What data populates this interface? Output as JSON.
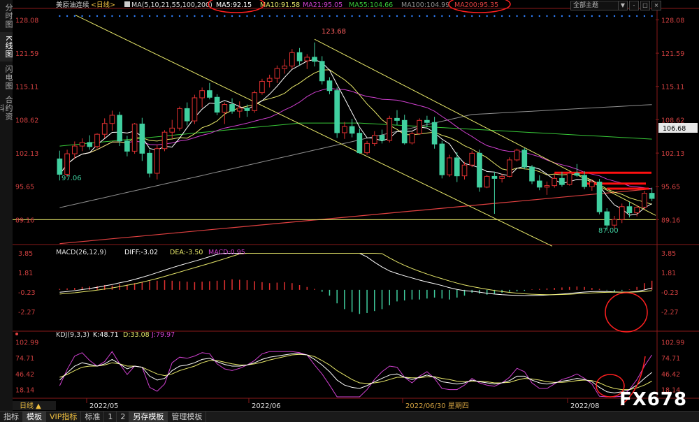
{
  "sidebar": {
    "tabs": [
      "分时图",
      "K线图",
      "闪电图",
      "合约资料"
    ],
    "active": 1
  },
  "header": {
    "symbol": "美原油连续",
    "period": "<日线>",
    "ma_label": "MA(5,10,21,55,100,200)",
    "ma_values": [
      {
        "label": "MA5:92.15",
        "color": "#ffffff"
      },
      {
        "label": "MA10:91.58",
        "color": "#e8e86a"
      },
      {
        "label": "MA21:95.05",
        "color": "#d040d0"
      },
      {
        "label": "MA55:104.66",
        "color": "#38c838"
      },
      {
        "label": "MA100:104.99",
        "color": "#909090"
      },
      {
        "label": "MA200:95.35",
        "color": "#e04040"
      }
    ],
    "theme": "全部主题",
    "buttons": [
      "▼",
      "-",
      "□",
      "×"
    ]
  },
  "main_axis": {
    "ticks": [
      "128.08",
      "121.59",
      "115.11",
      "108.62",
      "102.13",
      "95.65",
      "89.16"
    ],
    "last_price": "106.68"
  },
  "annotations": {
    "high": "123.68",
    "low_left": "97.06",
    "low_right": "87.00"
  },
  "macd": {
    "label": "MACD(26,12,9)",
    "diff": "DIFF:-3.02",
    "dea": "DEA:-3.50",
    "macd": "MACD:0.95",
    "ticks": [
      "3.85",
      "1.81",
      "-0.23",
      "-2.27"
    ]
  },
  "kdj": {
    "label": "KDJ(9,3,3)",
    "k": "K:48.71",
    "d": "D:33.08",
    "j": "J:79.97",
    "ticks": [
      "102.99",
      "74.71",
      "46.42",
      "18.14"
    ]
  },
  "date_axis": {
    "period_button": "日线 ▲",
    "labels": [
      "2022/05",
      "2022/06",
      "2022/06/30 星期四",
      "2022/08"
    ]
  },
  "bottom_tabs": [
    "指标",
    "模板",
    "VIP指标",
    "标准",
    "1",
    "2",
    "另存模板",
    "管理模板"
  ],
  "watermark": "FX678",
  "colors": {
    "up": "#e03030",
    "down": "#40d0a0",
    "ma5": "#ffffff",
    "ma10": "#e8e86a",
    "ma21": "#d040d0",
    "ma55": "#38c838",
    "ma100": "#909090",
    "ma200": "#e04040",
    "trend": "#e8e86a",
    "highlight": "#ff2020"
  },
  "chart_data": {
    "type": "candlestick",
    "candles": [
      [
        101.0,
        102.6,
        96.8,
        98.0
      ],
      [
        98.0,
        102.8,
        97.5,
        102.0
      ],
      [
        102.0,
        104.4,
        101.0,
        103.5
      ],
      [
        103.5,
        105.0,
        102.5,
        104.2
      ],
      [
        104.2,
        105.6,
        102.8,
        103.4
      ],
      [
        103.4,
        106.0,
        103.0,
        105.8
      ],
      [
        105.8,
        108.9,
        105.0,
        107.9
      ],
      [
        107.9,
        110.4,
        106.5,
        109.5
      ],
      [
        109.5,
        110.2,
        103.5,
        104.5
      ],
      [
        104.5,
        105.5,
        101.5,
        102.5
      ],
      [
        102.5,
        108.0,
        102.0,
        107.8
      ],
      [
        107.8,
        109.0,
        100.6,
        102.1
      ],
      [
        102.1,
        102.8,
        97.4,
        98.2
      ],
      [
        98.2,
        103.8,
        97.0,
        103.0
      ],
      [
        103.0,
        106.6,
        102.5,
        106.2
      ],
      [
        106.2,
        108.6,
        105.0,
        107.0
      ],
      [
        107.0,
        111.2,
        106.5,
        110.8
      ],
      [
        110.8,
        112.0,
        107.5,
        108.4
      ],
      [
        108.4,
        113.5,
        107.8,
        112.9
      ],
      [
        112.9,
        114.9,
        111.0,
        114.3
      ],
      [
        114.3,
        115.8,
        112.6,
        113.0
      ],
      [
        113.0,
        113.6,
        109.5,
        110.1
      ],
      [
        110.1,
        112.0,
        107.8,
        111.6
      ],
      [
        111.6,
        112.8,
        109.8,
        110.3
      ],
      [
        110.3,
        112.2,
        109.0,
        110.9
      ],
      [
        110.9,
        111.6,
        109.2,
        110.4
      ],
      [
        110.4,
        114.3,
        110.0,
        113.9
      ],
      [
        113.9,
        116.6,
        113.5,
        116.1
      ],
      [
        116.1,
        117.4,
        114.9,
        116.7
      ],
      [
        116.7,
        119.2,
        115.8,
        118.6
      ],
      [
        118.6,
        120.4,
        117.6,
        119.1
      ],
      [
        119.1,
        122.4,
        118.5,
        121.7
      ],
      [
        121.7,
        122.6,
        119.2,
        120.1
      ],
      [
        120.1,
        121.4,
        118.5,
        120.8
      ],
      [
        120.8,
        123.68,
        119.0,
        120.0
      ],
      [
        120.0,
        121.0,
        115.5,
        116.2
      ],
      [
        116.2,
        116.9,
        113.6,
        114.3
      ],
      [
        114.3,
        114.9,
        105.1,
        106.1
      ],
      [
        106.1,
        108.2,
        104.9,
        107.3
      ],
      [
        107.3,
        108.8,
        105.2,
        106.0
      ],
      [
        106.0,
        106.9,
        102.0,
        102.2
      ],
      [
        102.2,
        104.5,
        101.8,
        104.0
      ],
      [
        104.0,
        106.4,
        103.5,
        105.6
      ],
      [
        105.6,
        106.7,
        104.0,
        104.6
      ],
      [
        104.6,
        109.4,
        104.2,
        108.9
      ],
      [
        108.9,
        110.5,
        107.6,
        108.5
      ],
      [
        108.5,
        109.6,
        103.8,
        104.1
      ],
      [
        104.1,
        106.3,
        103.8,
        105.9
      ],
      [
        105.9,
        108.9,
        105.7,
        108.5
      ],
      [
        108.5,
        109.4,
        107.2,
        108.1
      ],
      [
        108.1,
        109.2,
        103.0,
        103.9
      ],
      [
        103.9,
        104.5,
        97.2,
        97.9
      ],
      [
        97.9,
        101.8,
        97.5,
        101.2
      ],
      [
        101.2,
        102.3,
        96.5,
        97.7
      ],
      [
        97.7,
        100.4,
        97.0,
        99.8
      ],
      [
        99.8,
        102.6,
        99.4,
        102.1
      ],
      [
        102.1,
        102.8,
        94.6,
        95.5
      ],
      [
        95.5,
        97.9,
        95.3,
        97.6
      ],
      [
        97.6,
        98.5,
        90.3,
        97.2
      ],
      [
        97.2,
        98.1,
        96.4,
        97.6
      ],
      [
        97.6,
        101.3,
        97.4,
        100.8
      ],
      [
        100.8,
        103.0,
        100.5,
        102.7
      ],
      [
        102.7,
        103.1,
        99.0,
        99.4
      ],
      [
        99.4,
        99.8,
        96.1,
        96.7
      ],
      [
        96.7,
        97.8,
        94.9,
        95.5
      ],
      [
        95.5,
        96.6,
        94.0,
        95.8
      ],
      [
        95.8,
        97.9,
        95.4,
        97.2
      ],
      [
        97.2,
        98.5,
        95.6,
        96.0
      ],
      [
        96.0,
        98.6,
        95.8,
        98.2
      ],
      [
        98.2,
        100.0,
        97.5,
        97.8
      ],
      [
        97.8,
        98.6,
        95.1,
        95.6
      ],
      [
        95.6,
        97.0,
        94.8,
        96.5
      ],
      [
        96.5,
        97.1,
        90.2,
        90.7
      ],
      [
        90.7,
        91.4,
        87.0,
        88.1
      ],
      [
        88.1,
        89.9,
        87.4,
        89.2
      ],
      [
        89.2,
        92.3,
        88.5,
        91.7
      ],
      [
        91.7,
        92.6,
        89.6,
        90.5
      ],
      [
        90.5,
        92.0,
        89.8,
        91.6
      ],
      [
        91.6,
        94.8,
        91.2,
        94.3
      ],
      [
        94.3,
        95.4,
        92.8,
        93.3
      ]
    ],
    "ylim": [
      85.0,
      129.5
    ],
    "horizontal_lines": [
      89.16,
      98.3,
      96.2,
      95.2
    ],
    "macd_hist": [
      0.1,
      0.15,
      0.2,
      0.3,
      0.35,
      0.4,
      0.5,
      0.45,
      0.6,
      0.55,
      0.7,
      0.8,
      0.9,
      0.95,
      1.0,
      0.95,
      0.9,
      0.85,
      0.8,
      0.85,
      0.9,
      0.95,
      1.0,
      1.1,
      1.05,
      1.0,
      0.9,
      0.8,
      0.7,
      0.75,
      0.8,
      0.7,
      0.5,
      0.3,
      0.1,
      -0.2,
      -0.6,
      -1.4,
      -2.0,
      -2.3,
      -2.5,
      -2.4,
      -2.2,
      -2.0,
      -1.6,
      -1.2,
      -1.1,
      -1.0,
      -1.0,
      -0.9,
      -0.8,
      -0.9,
      -1.0,
      -0.8,
      -0.6,
      -0.3,
      -0.4,
      -0.5,
      -0.4,
      -0.3,
      -0.2,
      -0.15,
      -0.1,
      0.05,
      0.1,
      0.15,
      0.2,
      0.25,
      0.3,
      0.35,
      0.3,
      0.2,
      0.1,
      -0.05,
      -0.2,
      -0.1,
      0.05,
      0.3,
      0.7,
      0.95
    ],
    "kdj_k": [
      35,
      48,
      60,
      66,
      63,
      60,
      64,
      72,
      64,
      55,
      60,
      58,
      42,
      35,
      38,
      52,
      60,
      62,
      66,
      72,
      74,
      68,
      63,
      60,
      60,
      62,
      66,
      72,
      76,
      78,
      80,
      82,
      82,
      80,
      72,
      62,
      50,
      35,
      26,
      22,
      20,
      25,
      32,
      38,
      44,
      46,
      40,
      36,
      40,
      44,
      40,
      32,
      30,
      28,
      30,
      35,
      32,
      30,
      28,
      30,
      34,
      42,
      42,
      35,
      30,
      28,
      30,
      33,
      35,
      38,
      36,
      32,
      22,
      14,
      12,
      14,
      18,
      26,
      38,
      48.71
    ],
    "kdj_d": [
      40,
      45,
      52,
      58,
      60,
      60,
      62,
      66,
      64,
      60,
      60,
      58,
      52,
      46,
      43,
      46,
      52,
      56,
      60,
      66,
      70,
      70,
      67,
      64,
      62,
      62,
      64,
      67,
      71,
      74,
      77,
      80,
      81,
      80,
      77,
      70,
      62,
      52,
      44,
      36,
      30,
      29,
      30,
      32,
      36,
      40,
      40,
      39,
      39,
      41,
      41,
      38,
      36,
      33,
      32,
      33,
      33,
      32,
      30,
      30,
      31,
      35,
      38,
      37,
      35,
      32,
      31,
      31,
      32,
      34,
      35,
      34,
      30,
      24,
      20,
      18,
      18,
      21,
      26,
      33.08
    ],
    "kdj_j": [
      25,
      54,
      78,
      84,
      70,
      60,
      68,
      86,
      64,
      45,
      60,
      58,
      22,
      15,
      28,
      66,
      76,
      74,
      78,
      84,
      82,
      64,
      55,
      52,
      56,
      62,
      70,
      82,
      86,
      86,
      86,
      86,
      84,
      80,
      62,
      46,
      26,
      0,
      -10,
      -6,
      0,
      18,
      36,
      50,
      60,
      58,
      40,
      30,
      42,
      50,
      38,
      20,
      18,
      18,
      26,
      38,
      30,
      26,
      24,
      30,
      40,
      56,
      50,
      30,
      20,
      20,
      28,
      36,
      40,
      46,
      38,
      28,
      6,
      -6,
      -4,
      6,
      18,
      36,
      60,
      79.97
    ]
  }
}
